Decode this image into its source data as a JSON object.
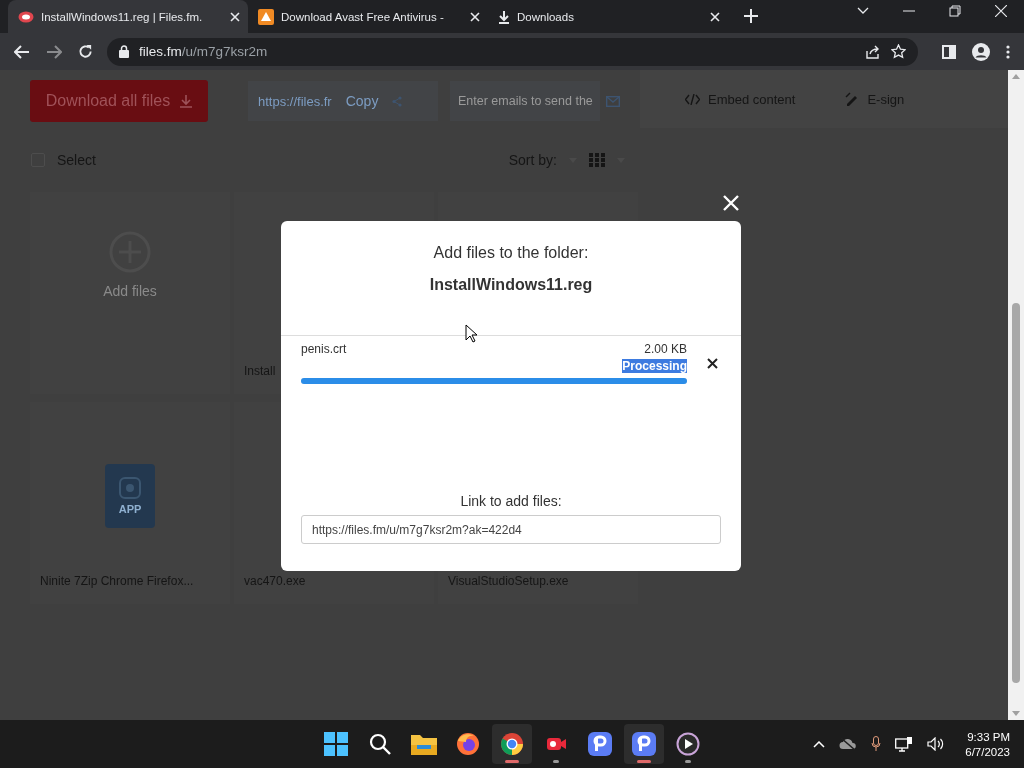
{
  "browser": {
    "tabs": [
      {
        "title": "InstallWindows11.reg | Files.fm.",
        "selected": true
      },
      {
        "title": "Download Avast Free Antivirus -",
        "selected": false
      },
      {
        "title": "Downloads",
        "selected": false
      }
    ],
    "address": {
      "host": "files.fm",
      "path": "/u/m7g7ksr2m"
    }
  },
  "page": {
    "toolbar": {
      "download_button": "Download all files",
      "link_value": "https://files.fr",
      "copy_button": "Copy",
      "email_placeholder": "Enter emails to send the",
      "embed_button": "Embed content",
      "esign_button": "E-sign"
    },
    "select": {
      "label": "Select",
      "checked": false
    },
    "sort_label": "Sort by:",
    "files": [
      {
        "kind": "add",
        "name": "Add files"
      },
      {
        "kind": "file",
        "name": "Install"
      },
      {
        "kind": "hidden"
      },
      {
        "kind": "app",
        "name": "Ninite 7Zip Chrome Firefox...",
        "badge": "APP"
      },
      {
        "kind": "file",
        "name": "vac470.exe"
      },
      {
        "kind": "file",
        "name": "VisualStudioSetup.exe"
      }
    ]
  },
  "modal": {
    "title": "Add files to the folder:",
    "folder": "InstallWindows11.reg",
    "uploads": [
      {
        "name": "penis.crt",
        "size": "2.00 KB",
        "status": "Processing",
        "level": 1
      }
    ],
    "link_label": "Link to add files:",
    "link_value": "https://files.fm/u/m7g7ksr2m?ak=422d4"
  },
  "taskbar": {
    "apps": [
      {
        "kind": "start",
        "running": false,
        "selected": false
      },
      {
        "kind": "search",
        "running": false,
        "selected": false
      },
      {
        "kind": "folder",
        "running": false,
        "selected": false
      },
      {
        "kind": "firefox",
        "running": false,
        "selected": false
      },
      {
        "kind": "chrome",
        "running": true,
        "selected": true
      },
      {
        "kind": "recorder",
        "running": true,
        "selected": false
      },
      {
        "kind": "p-app",
        "running": false,
        "selected": false
      },
      {
        "kind": "p-app",
        "running": true,
        "selected": true
      },
      {
        "kind": "player",
        "running": true,
        "selected": false
      }
    ],
    "time": "9:33 PM",
    "date": "6/7/2023"
  }
}
